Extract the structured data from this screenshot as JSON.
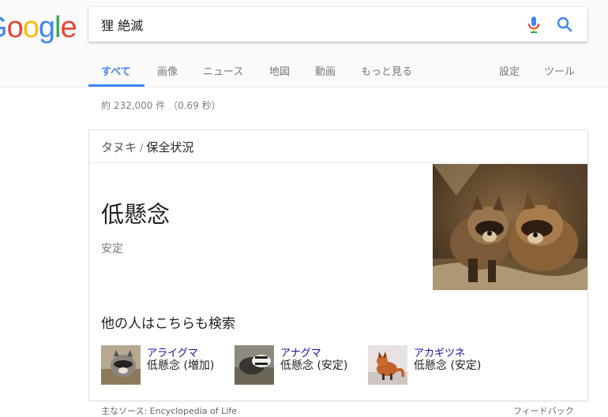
{
  "logo": {
    "letters": [
      "o",
      "o",
      "g",
      "l",
      "e"
    ],
    "partial_letter": "G"
  },
  "search": {
    "query": "狸 絶滅"
  },
  "tabs": [
    {
      "label": "すべて",
      "active": true
    },
    {
      "label": "画像"
    },
    {
      "label": "ニュース"
    },
    {
      "label": "地図"
    },
    {
      "label": "動画"
    },
    {
      "label": "もっと見る"
    },
    {
      "label": "設定"
    },
    {
      "label": "ツール"
    }
  ],
  "stats": "約 232,000 件 （0.69 秒）",
  "card": {
    "breadcrumb_parent": "タヌキ",
    "breadcrumb_sep": "/",
    "breadcrumb_current": "保全状況",
    "status": "低懸念",
    "status_sub": "安定",
    "also_search_title": "他の人はこちらも検索",
    "related": [
      {
        "name": "アライグマ",
        "status": "低懸念 (増加)"
      },
      {
        "name": "アナグマ",
        "status": "低懸念 (安定)"
      },
      {
        "name": "アカギツネ",
        "status": "低懸念 (安定)"
      }
    ]
  },
  "footer": {
    "source": "主なソース: Encyclopedia of Life",
    "feedback": "フィードバック"
  },
  "colors": {
    "blue": "#4285f4",
    "red": "#ea4335",
    "yellow": "#fbbc05",
    "green": "#34a853",
    "link": "#1a0dab"
  }
}
